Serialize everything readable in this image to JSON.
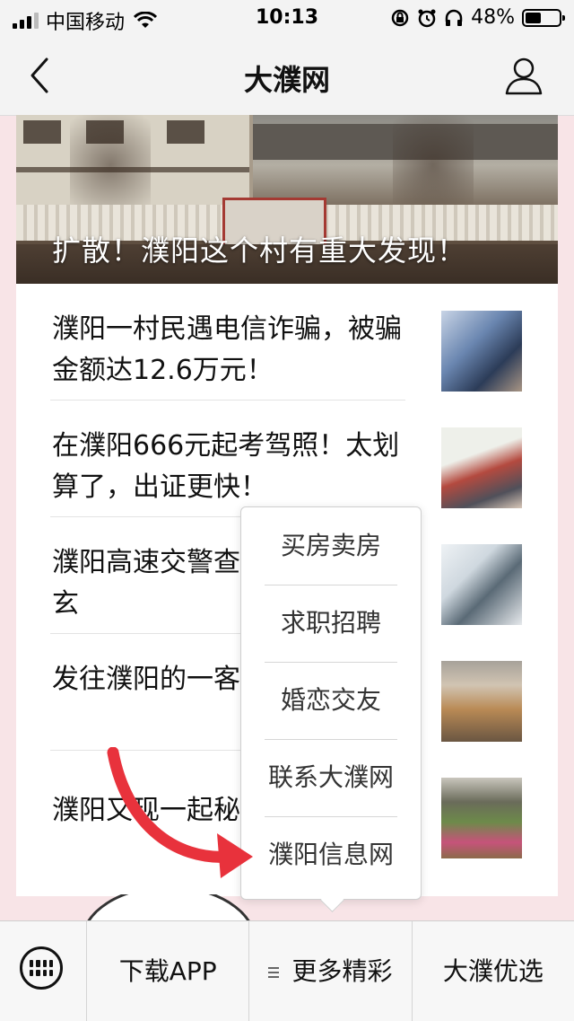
{
  "status_bar": {
    "carrier": "中国移动",
    "time": "10:13",
    "battery_percent": "48%",
    "battery_level": 0.48
  },
  "nav": {
    "title": "大濮网",
    "back_icon": "chevron-left-icon",
    "user_icon": "user-icon"
  },
  "hero": {
    "title": "扩散！濮阳这个村有重大发现！"
  },
  "news": [
    {
      "title": "濮阳一村民遇电信诈骗，被骗金额达12.6万元！"
    },
    {
      "title": "在濮阳666元起考驾照！太划算了，出证更快！"
    },
    {
      "title": "濮阳高速交警查车，车内暗藏玄"
    },
    {
      "title": "发往濮阳的一客事当场被查！"
    },
    {
      "title": "濮阳又现一起秘"
    }
  ],
  "popup_menu": {
    "items": [
      "买房卖房",
      "求职招聘",
      "婚恋交友",
      "联系大濮网",
      "濮阳信息网"
    ]
  },
  "bottom_bar": {
    "keyboard_icon": "keyboard-icon",
    "download_app": "下载APP",
    "more": "更多精彩",
    "select": "大濮优选"
  },
  "colors": {
    "accent_red": "#e8323c",
    "background_pink": "#f8e4e7"
  }
}
